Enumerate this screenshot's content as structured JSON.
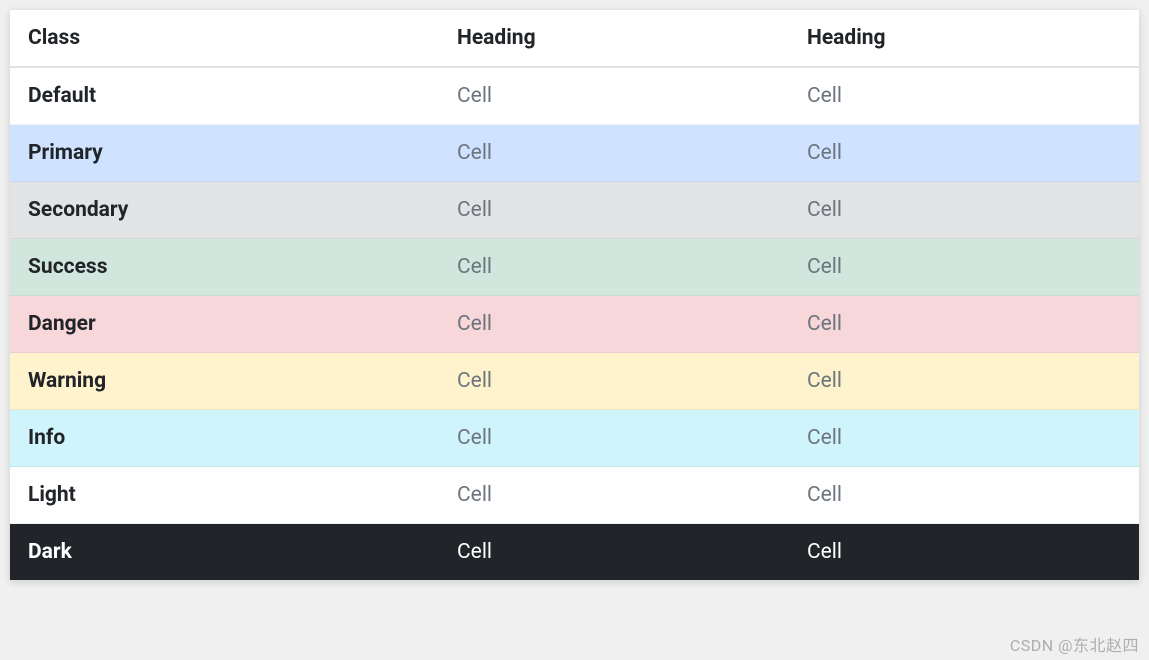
{
  "table": {
    "headers": [
      "Class",
      "Heading",
      "Heading"
    ],
    "rows": [
      {
        "variant": "default",
        "label": "Default",
        "cells": [
          "Cell",
          "Cell"
        ]
      },
      {
        "variant": "primary",
        "label": "Primary",
        "cells": [
          "Cell",
          "Cell"
        ]
      },
      {
        "variant": "secondary",
        "label": "Secondary",
        "cells": [
          "Cell",
          "Cell"
        ]
      },
      {
        "variant": "success",
        "label": "Success",
        "cells": [
          "Cell",
          "Cell"
        ]
      },
      {
        "variant": "danger",
        "label": "Danger",
        "cells": [
          "Cell",
          "Cell"
        ]
      },
      {
        "variant": "warning",
        "label": "Warning",
        "cells": [
          "Cell",
          "Cell"
        ]
      },
      {
        "variant": "info",
        "label": "Info",
        "cells": [
          "Cell",
          "Cell"
        ]
      },
      {
        "variant": "light",
        "label": "Light",
        "cells": [
          "Cell",
          "Cell"
        ]
      },
      {
        "variant": "dark",
        "label": "Dark",
        "cells": [
          "Cell",
          "Cell"
        ]
      }
    ]
  },
  "colors": {
    "default": "#ffffff",
    "primary": "#cfe2ff",
    "secondary": "#e2e3e5",
    "success": "#d1e7dd",
    "danger": "#f8d7da",
    "warning": "#fff3cd",
    "info": "#cff4fc",
    "light": "#fefefe",
    "dark": "#212529"
  },
  "watermark": "CSDN @东北赵四"
}
